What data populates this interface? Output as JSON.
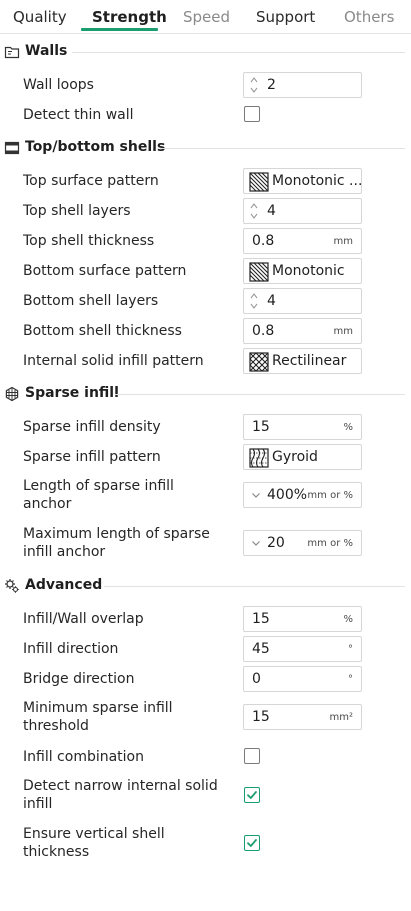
{
  "tabs": [
    {
      "label": "Quality",
      "active": false
    },
    {
      "label": "Strength",
      "active": true
    },
    {
      "label": "Speed",
      "active": false
    },
    {
      "label": "Support",
      "active": false
    },
    {
      "label": "Others",
      "active": false
    }
  ],
  "accent_color": "#1a9e6f",
  "sections": {
    "walls": {
      "title": "Walls",
      "icon": "walls-icon",
      "wall_loops": {
        "label": "Wall loops",
        "value": "2"
      },
      "detect_thin_wall": {
        "label": "Detect thin wall",
        "checked": false
      }
    },
    "shells": {
      "title": "Top/bottom shells",
      "icon": "shells-icon",
      "top_surface_pattern": {
        "label": "Top surface pattern",
        "value": "Monotonic ..."
      },
      "top_shell_layers": {
        "label": "Top shell layers",
        "value": "4"
      },
      "top_shell_thickness": {
        "label": "Top shell thickness",
        "value": "0.8",
        "unit": "mm"
      },
      "bottom_surface_pattern": {
        "label": "Bottom surface pattern",
        "value": "Monotonic"
      },
      "bottom_shell_layers": {
        "label": "Bottom shell layers",
        "value": "4"
      },
      "bottom_shell_thickness": {
        "label": "Bottom shell thickness",
        "value": "0.8",
        "unit": "mm"
      },
      "internal_solid_infill_pattern": {
        "label": "Internal solid infill pattern",
        "value": "Rectilinear"
      }
    },
    "sparse": {
      "title": "Sparse infill",
      "icon": "sparse-infill-icon",
      "density": {
        "label": "Sparse infill density",
        "value": "15",
        "unit": "%"
      },
      "pattern": {
        "label": "Sparse infill pattern",
        "value": "Gyroid"
      },
      "anchor": {
        "label": "Length of sparse infill anchor",
        "value": "400%",
        "unit": "mm or %"
      },
      "max_anchor": {
        "label": "Maximum length of sparse infill anchor",
        "value": "20",
        "unit": "mm or %"
      }
    },
    "advanced": {
      "title": "Advanced",
      "icon": "advanced-gear-icon",
      "overlap": {
        "label": "Infill/Wall overlap",
        "value": "15",
        "unit": "%"
      },
      "infill_direction": {
        "label": "Infill direction",
        "value": "45",
        "unit": "°"
      },
      "bridge_direction": {
        "label": "Bridge direction",
        "value": "0",
        "unit": "°"
      },
      "min_sparse_threshold": {
        "label": "Minimum sparse infill threshold",
        "value": "15",
        "unit": "mm²"
      },
      "infill_combination": {
        "label": "Infill combination",
        "checked": false
      },
      "detect_narrow": {
        "label": "Detect narrow internal solid infill",
        "checked": true
      },
      "ensure_vertical": {
        "label": "Ensure vertical shell thickness",
        "checked": true
      }
    }
  }
}
